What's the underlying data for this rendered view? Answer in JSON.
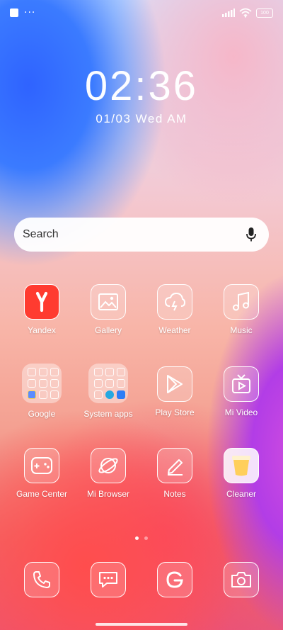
{
  "status": {
    "dots": "···",
    "battery": "100"
  },
  "clock": {
    "time": "02:36",
    "date": "01/03 Wed AM"
  },
  "search": {
    "placeholder": "Search"
  },
  "apps": [
    {
      "label": "Yandex",
      "icon": "yandex-icon"
    },
    {
      "label": "Gallery",
      "icon": "gallery-icon"
    },
    {
      "label": "Weather",
      "icon": "weather-icon"
    },
    {
      "label": "Music",
      "icon": "music-icon"
    },
    {
      "label": "Google",
      "icon": "folder-icon"
    },
    {
      "label": "System apps",
      "icon": "folder-icon"
    },
    {
      "label": "Play Store",
      "icon": "play-store-icon"
    },
    {
      "label": "Mi Video",
      "icon": "video-icon"
    },
    {
      "label": "Game Center",
      "icon": "gamepad-icon"
    },
    {
      "label": "Mi Browser",
      "icon": "browser-icon"
    },
    {
      "label": "Notes",
      "icon": "notes-icon"
    },
    {
      "label": "Cleaner",
      "icon": "cleaner-icon"
    }
  ],
  "dock": [
    {
      "icon": "phone-icon"
    },
    {
      "icon": "messages-icon"
    },
    {
      "icon": "google-icon"
    },
    {
      "icon": "camera-icon"
    }
  ],
  "colors": {
    "yandex": "#ff3b30",
    "cleaner": "#ffcf5c"
  }
}
